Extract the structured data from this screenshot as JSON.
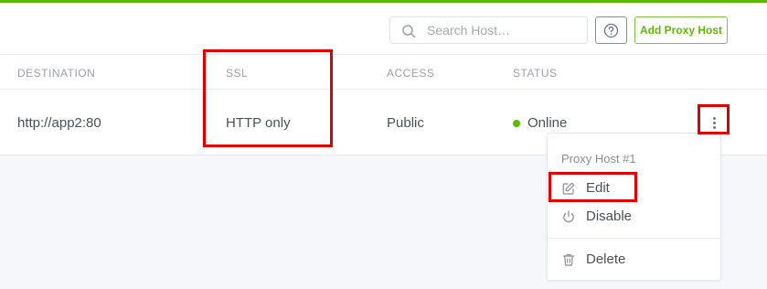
{
  "toolbar": {
    "search_placeholder": "Search Host…",
    "help_icon": "question-circle-icon",
    "add_button_label": "Add Proxy Host"
  },
  "table": {
    "columns": [
      "DESTINATION",
      "SSL",
      "ACCESS",
      "STATUS"
    ],
    "rows": [
      {
        "destination": "http://app2:80",
        "ssl": "HTTP only",
        "access": "Public",
        "status": "Online",
        "status_color": "#5eba00"
      }
    ]
  },
  "row_menu": {
    "header": "Proxy Host #1",
    "items": [
      {
        "label": "Edit",
        "icon": "edit-icon"
      },
      {
        "label": "Disable",
        "icon": "power-icon"
      },
      {
        "label": "Delete",
        "icon": "trash-icon"
      }
    ]
  },
  "colors": {
    "accent": "#5eba00",
    "highlight": "#e00000"
  }
}
